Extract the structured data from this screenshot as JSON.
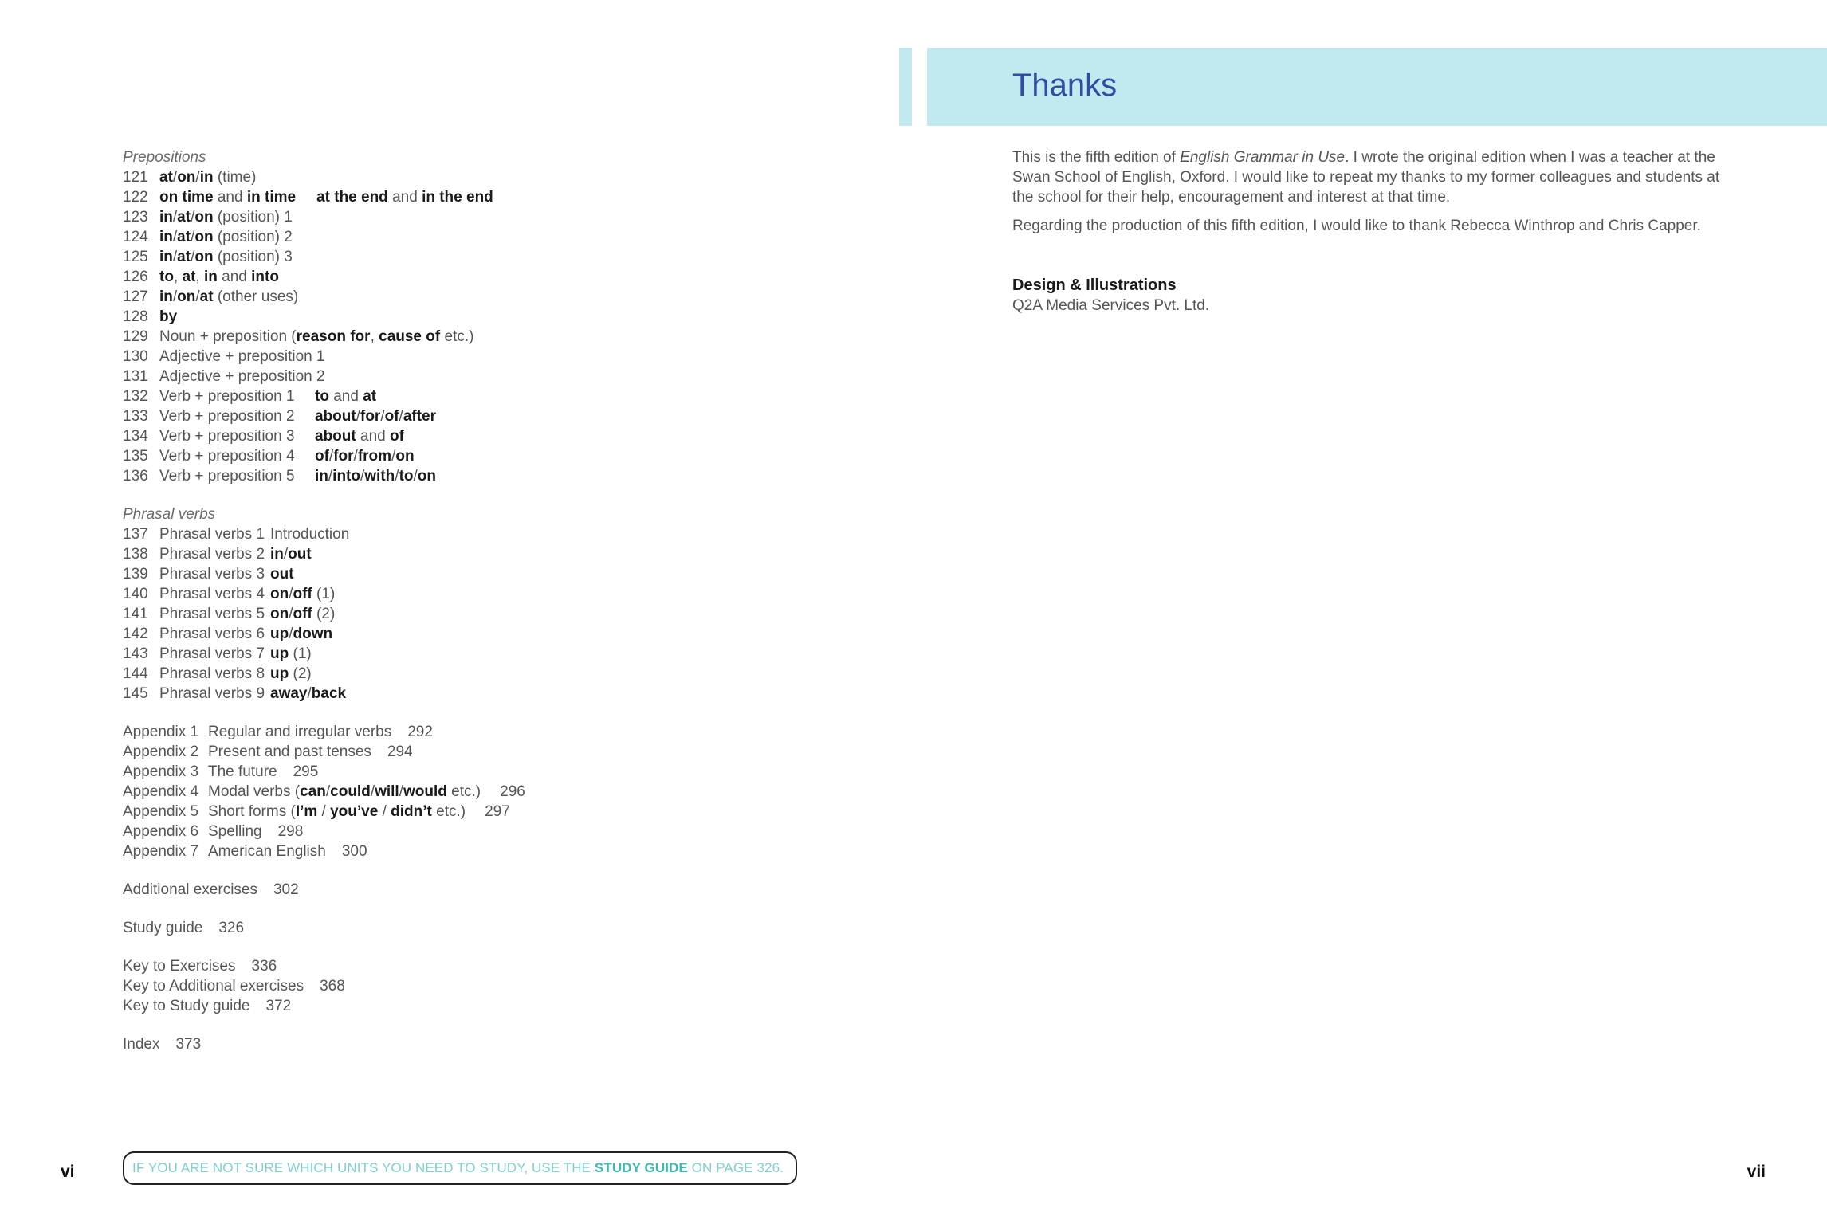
{
  "left_page": {
    "prepositions_heading": "Prepositions",
    "prepositions": [
      {
        "num": "121",
        "a": "at",
        "b": "on",
        "c": "in",
        "d": " (time)"
      },
      {
        "num": "122",
        "a": "on time",
        "b": " and ",
        "c": "in time",
        "d": "at the end",
        "e": " and ",
        "f": "in the end"
      },
      {
        "num": "123",
        "a": "in",
        "b": "at",
        "c": "on",
        "d": " (position) 1"
      },
      {
        "num": "124",
        "a": "in",
        "b": "at",
        "c": "on",
        "d": " (position) 2"
      },
      {
        "num": "125",
        "a": "in",
        "b": "at",
        "c": "on",
        "d": " (position) 3"
      },
      {
        "num": "126",
        "a": "to",
        "b": "at",
        "c": "in",
        "d": " and ",
        "e": "into"
      },
      {
        "num": "127",
        "a": "in",
        "b": "on",
        "c": "at",
        "d": " (other uses)"
      },
      {
        "num": "128",
        "a": "by"
      },
      {
        "num": "129",
        "a": "Noun + preposition (",
        "b": "reason for",
        "c": ", ",
        "d": "cause of",
        "e": " etc.)"
      },
      {
        "num": "130",
        "a": "Adjective + preposition 1"
      },
      {
        "num": "131",
        "a": "Adjective + preposition 2"
      },
      {
        "num": "132",
        "a": "Verb + preposition 1",
        "b": "to",
        "c": " and ",
        "d": "at"
      },
      {
        "num": "133",
        "a": "Verb + preposition 2",
        "b": "about",
        "c": "for",
        "d": "of",
        "e": "after"
      },
      {
        "num": "134",
        "a": "Verb + preposition 3",
        "b": "about",
        "c": " and ",
        "d": "of"
      },
      {
        "num": "135",
        "a": "Verb + preposition 4",
        "b": "of",
        "c": "for",
        "d": "from",
        "e": "on"
      },
      {
        "num": "136",
        "a": "Verb + preposition 5",
        "b": "in",
        "c": "into",
        "d": "with",
        "e": "to",
        "f": "on"
      }
    ],
    "phrasal_heading": "Phrasal verbs",
    "phrasal": [
      {
        "num": "137",
        "label": "Phrasal verbs 1",
        "a": "Introduction"
      },
      {
        "num": "138",
        "label": "Phrasal verbs 2",
        "a": "in",
        "b": "out"
      },
      {
        "num": "139",
        "label": "Phrasal verbs 3",
        "a": "out"
      },
      {
        "num": "140",
        "label": "Phrasal verbs 4",
        "a": "on",
        "b": "off",
        "c": " (1)"
      },
      {
        "num": "141",
        "label": "Phrasal verbs 5",
        "a": "on",
        "b": "off",
        "c": " (2)"
      },
      {
        "num": "142",
        "label": "Phrasal verbs 6",
        "a": "up",
        "b": "down"
      },
      {
        "num": "143",
        "label": "Phrasal verbs 7",
        "a": "up",
        "c": " (1)"
      },
      {
        "num": "144",
        "label": "Phrasal verbs 8",
        "a": "up",
        "c": " (2)"
      },
      {
        "num": "145",
        "label": "Phrasal verbs 9",
        "a": "away",
        "b": "back"
      }
    ],
    "appendices": [
      {
        "label": "Appendix 1",
        "title": "Regular and irregular verbs",
        "page": "292"
      },
      {
        "label": "Appendix 2",
        "title": "Present and past tenses",
        "page": "294"
      },
      {
        "label": "Appendix 3",
        "title": "The future",
        "page": "295"
      },
      {
        "label": "Appendix 4",
        "t1": "Modal verbs (",
        "b1": "can",
        "b2": "could",
        "b3": "will",
        "b4": "would",
        "t2": " etc.)",
        "page": "296"
      },
      {
        "label": "Appendix 5",
        "t1": "Short forms (",
        "b1": "I’m",
        "b2": "you’ve",
        "b3": "didn’t",
        "t2": " etc.)",
        "page": "297"
      },
      {
        "label": "Appendix 6",
        "title": "Spelling",
        "page": "298"
      },
      {
        "label": "Appendix 7",
        "title": "American English",
        "page": "300"
      }
    ],
    "additional": {
      "label": "Additional exercises",
      "page": "302"
    },
    "study_guide": {
      "label": "Study guide",
      "page": "326"
    },
    "keys": [
      {
        "label": "Key to Exercises",
        "page": "336"
      },
      {
        "label": "Key to Additional exercises",
        "page": "368"
      },
      {
        "label": "Key to Study guide",
        "page": "372"
      }
    ],
    "index": {
      "label": "Index",
      "page": "373"
    },
    "page_number": "vi",
    "guide_box": {
      "pre": "IF YOU ARE NOT SURE WHICH UNITS YOU NEED TO STUDY, USE THE ",
      "strong": "STUDY GUIDE",
      "post": " ON PAGE 326."
    }
  },
  "right_page": {
    "title": "Thanks",
    "p1_a": "This is the fifth edition of ",
    "p1_italic": "English Grammar in Use",
    "p1_b": ".  I wrote the original edition when I was a teacher at the Swan School of English, Oxford.  I would like to repeat my thanks to my former colleagues and students at the school for their help, encouragement and interest at that time.",
    "p2": "Regarding the production of this fifth edition, I would like to thank Rebecca Winthrop and Chris Capper.",
    "credit_heading": "Design & Illustrations",
    "credit_body": "Q2A Media Services Pvt. Ltd.",
    "page_number": "vii"
  },
  "colors": {
    "band": "#c2e9ef",
    "title": "#2f4ea3",
    "guide_text": "#7fd0cc",
    "guide_strong": "#3fb8b0"
  }
}
